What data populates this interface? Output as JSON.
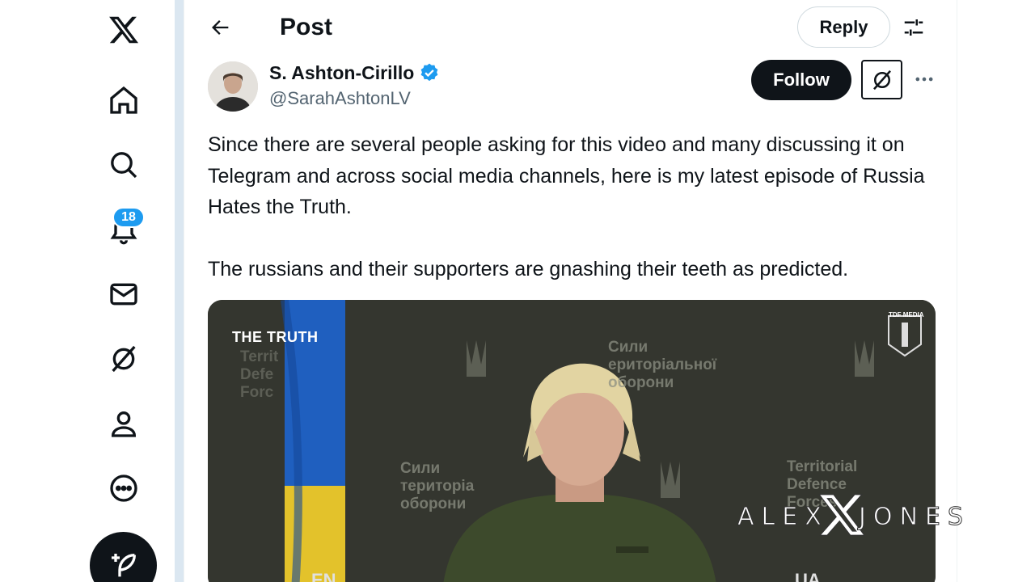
{
  "nav": {
    "items": [
      {
        "name": "home",
        "icon": "home-icon"
      },
      {
        "name": "explore",
        "icon": "search-icon"
      },
      {
        "name": "notifications",
        "icon": "bell-icon",
        "badge": "18"
      },
      {
        "name": "messages",
        "icon": "mail-icon"
      },
      {
        "name": "grok",
        "icon": "grok-icon"
      },
      {
        "name": "profile",
        "icon": "person-icon"
      },
      {
        "name": "more",
        "icon": "more-circle-icon"
      }
    ],
    "compose_icon": "feather-plus-icon"
  },
  "header": {
    "title": "Post",
    "reply_label": "Reply"
  },
  "post": {
    "author_name": "S. Ashton-Cirillo",
    "handle": "@SarahAshtonLV",
    "follow_label": "Follow",
    "text": "Since there are several people asking for this video and many discussing it on Telegram and across social media channels, here is my latest episode of Russia Hates the Truth.\n\nThe russians and their supporters are gnashing their teeth as predicted."
  },
  "video": {
    "overlay_title": "THE TRUTH",
    "corner_label": "TDF MEDIA",
    "wall_text_ua_top": "Сили\nериторіальної\nоборони",
    "wall_text_ua_mid": "Сили\nтериторіа\nоборони",
    "wall_text_en_left": "Territ\nDefe\nForc",
    "wall_text_en_right": "Territorial\nDefence\nForces",
    "lang_left": "EN",
    "lang_right": "UA"
  },
  "watermark": {
    "left": "ALEX",
    "right": "JONES"
  },
  "colors": {
    "accent": "#1d9bf0",
    "text": "#0f1419",
    "secondary": "#536471"
  }
}
